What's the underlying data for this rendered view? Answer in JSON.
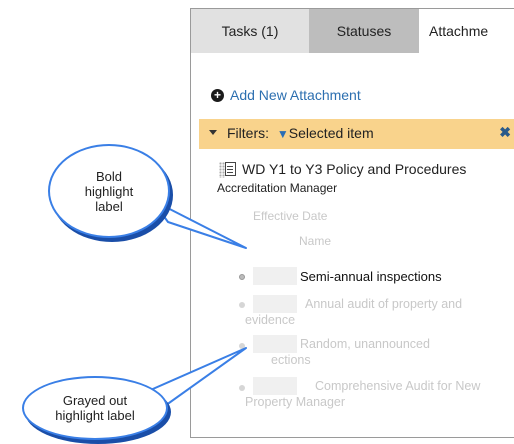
{
  "tabs": [
    {
      "label": "Tasks (1)"
    },
    {
      "label": "Statuses"
    },
    {
      "label": "Attachme"
    }
  ],
  "add_attachment": {
    "label": "Add New Attachment",
    "icon": "plus-circle-icon"
  },
  "filters": {
    "prefix": "Filters:",
    "value": "Selected item",
    "icon": "funnel-icon",
    "close_icon": "close-icon"
  },
  "document": {
    "title": "WD Y1 to Y3 Policy and Procedures",
    "subtitle": "Accreditation Manager"
  },
  "faded_fields": {
    "effective_date": "Effective Date",
    "name": "Name"
  },
  "items": [
    {
      "text": "Semi-annual inspections",
      "state": "bold"
    },
    {
      "text_line1": "Annual audit of property and",
      "text_line2": "evidence",
      "state": "grayed"
    },
    {
      "text_line1": "Random, unannounced",
      "text_line2": "ections",
      "state": "grayed"
    },
    {
      "text_line1": "Comprehensive Audit for New",
      "text_line2": "Property Manager",
      "state": "grayed"
    }
  ],
  "callouts": {
    "bold": {
      "line1": "Bold",
      "line2": "highlight",
      "line3": "label"
    },
    "grayed": {
      "line1": "Grayed out",
      "line2": "highlight label"
    }
  },
  "colors": {
    "filter_bar": "#f9d38c",
    "link": "#2c6fb0",
    "callout_border": "#3a7fe6"
  }
}
